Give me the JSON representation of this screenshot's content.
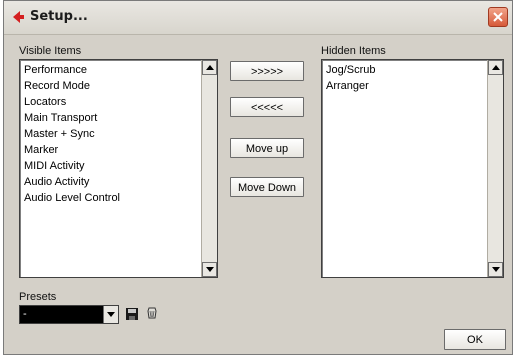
{
  "window": {
    "title": "Setup...",
    "colors": {
      "titlebar": "#d8d5cd",
      "background": "#d4d0c8",
      "close": "#d65a3a"
    }
  },
  "visible_items": {
    "label": "Visible Items",
    "items": [
      "Performance",
      "Record Mode",
      "Locators",
      "Main Transport",
      "Master + Sync",
      "Marker",
      "MIDI Activity",
      "Audio Activity",
      "Audio Level Control"
    ]
  },
  "hidden_items": {
    "label": "Hidden Items",
    "items": [
      "Jog/Scrub",
      "Arranger"
    ]
  },
  "buttons": {
    "move_right": ">>>>>",
    "move_left": "<<<<<",
    "move_up": "Move up",
    "move_down": "Move Down",
    "ok": "OK"
  },
  "presets": {
    "label": "Presets",
    "selected": "-",
    "icons": [
      "save-icon",
      "delete-icon"
    ]
  }
}
